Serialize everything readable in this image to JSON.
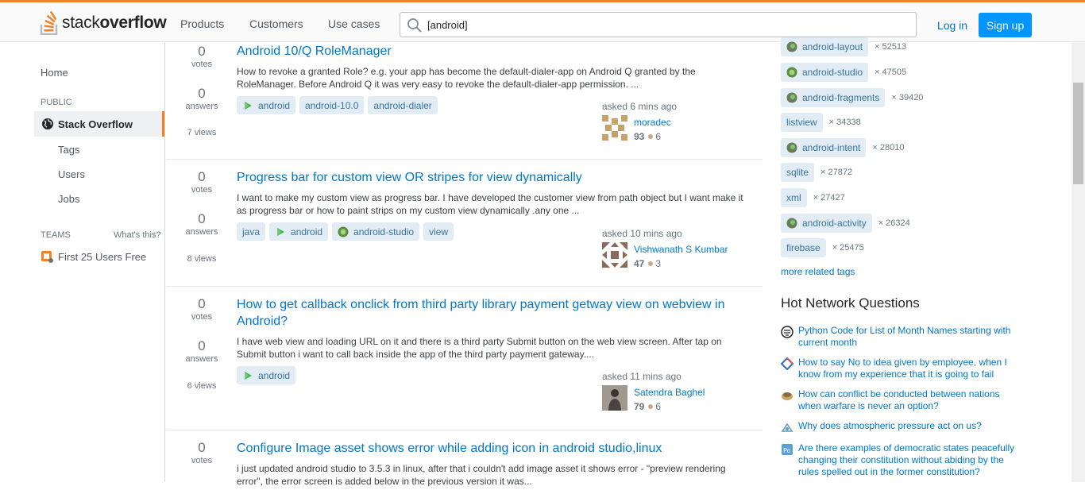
{
  "header": {
    "logo_pre": "stack",
    "logo_bold": "overflow",
    "nav": [
      "Products",
      "Customers",
      "Use cases"
    ],
    "search_value": "[android]",
    "login": "Log in",
    "signup": "Sign up"
  },
  "leftnav": {
    "home": "Home",
    "public_label": "PUBLIC",
    "stack_overflow": "Stack Overflow",
    "tags": "Tags",
    "users": "Users",
    "jobs": "Jobs",
    "teams_label": "TEAMS",
    "whats_this": "What's this?",
    "teams_item": "First 25 Users Free"
  },
  "questions": [
    {
      "votes": "0",
      "votes_label": "votes",
      "answers": "0",
      "answers_label": "answers",
      "views": "7 views",
      "title": "Android 10/Q RoleManager",
      "excerpt": "How to revoke a granted Role? e.g. your app has become the default-dialer-app on Android Q granted by the RoleManager. Before Android Q it was very easy to revoke the default-dialer-app permission. ...",
      "tags": [
        "android",
        "android-10.0",
        "android-dialer"
      ],
      "asked": "asked 6 mins ago",
      "user": "moradec",
      "rep": "93",
      "bronze": "6"
    },
    {
      "votes": "0",
      "votes_label": "votes",
      "answers": "0",
      "answers_label": "answers",
      "views": "8 views",
      "title": "Progress bar for custom view OR stripes for view dynamically",
      "excerpt": "I want to make my custom view as progress bar. I have developed the customer view from path object but I want make it as progress bar or how to paint strips on my custom view dynamically .any one ...",
      "tags": [
        "java",
        "android",
        "android-studio",
        "view"
      ],
      "asked": "asked 10 mins ago",
      "user": "Vishwanath S Kumbar",
      "rep": "47",
      "bronze": "3"
    },
    {
      "votes": "0",
      "votes_label": "votes",
      "answers": "0",
      "answers_label": "answers",
      "views": "6 views",
      "title": "How to get callback onclick from third party library payment getway view on webview in Android?",
      "excerpt": "I have web view and loading URL on it and there is a third party Submit button on the web view screen. After tap on Submit button i want to call back inside the app of the third party payment gateway....",
      "tags": [
        "android"
      ],
      "asked": "asked 11 mins ago",
      "user": "Satendra Baghel",
      "rep": "79",
      "bronze": "6"
    },
    {
      "votes": "0",
      "votes_label": "votes",
      "title": "Configure Image asset shows error while adding icon in android studio,linux",
      "excerpt": "i just updated android studio to 3.5.3 in linux, after that i couldn't add image asset it shows error - \"preview rendering error\", the error screen is added below in the previous version it was..."
    }
  ],
  "related_tags": [
    {
      "name": "android-layout",
      "count": "× 52513",
      "icon": "android-icon"
    },
    {
      "name": "android-studio",
      "count": "× 47505",
      "icon": "android-studio-icon"
    },
    {
      "name": "android-fragments",
      "count": "× 39420",
      "icon": "android-icon"
    },
    {
      "name": "listview",
      "count": "× 34338",
      "icon": ""
    },
    {
      "name": "android-intent",
      "count": "× 28010",
      "icon": "android-icon"
    },
    {
      "name": "sqlite",
      "count": "× 27872",
      "icon": ""
    },
    {
      "name": "xml",
      "count": "× 27427",
      "icon": ""
    },
    {
      "name": "android-activity",
      "count": "× 26324",
      "icon": "android-icon"
    },
    {
      "name": "firebase",
      "count": "× 25475",
      "icon": ""
    }
  ],
  "more_related_tags": "more related tags",
  "hot_network": {
    "title": "Hot Network Questions",
    "items": [
      {
        "text": "Python Code for List of Month Names starting with current month",
        "icon": "codegolf-icon"
      },
      {
        "text": "How to say No to idea given by employee, when I know from my experience that it is going to fail",
        "icon": "workplace-icon"
      },
      {
        "text": "How can conflict be conducted between nations when warfare is never an option?",
        "icon": "worldbuilding-icon"
      },
      {
        "text": "Why does atmospheric pressure act on us?",
        "icon": "physics-icon"
      },
      {
        "text": "Are there examples of democratic states peacefully changing their constitution without abiding by the rules spelled out in the former constitution?",
        "icon": "politics-icon"
      }
    ]
  },
  "colors": {
    "accent": "#f48024",
    "link": "#0077cc",
    "tag_bg": "#e1ecf4",
    "tag_fg": "#39739d",
    "signup": "#0095ff"
  }
}
